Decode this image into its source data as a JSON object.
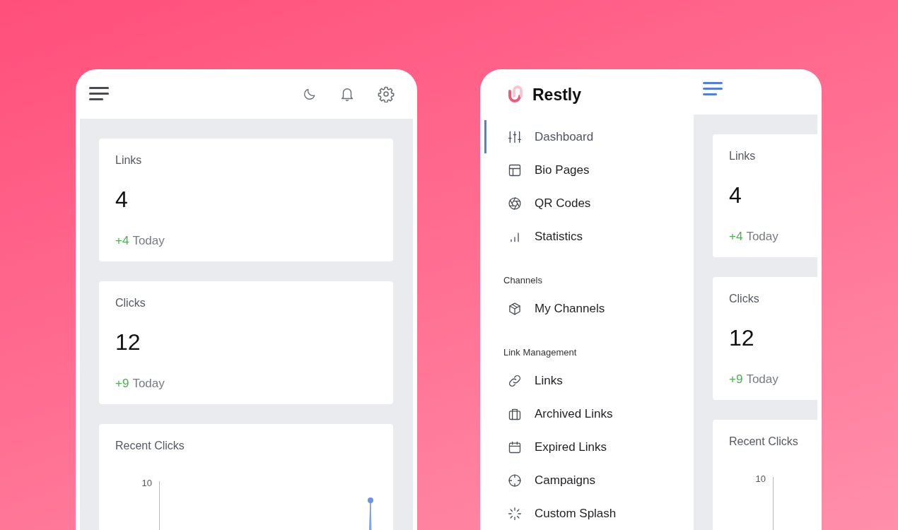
{
  "left_phone": {
    "stats": [
      {
        "label": "Links",
        "value": "4",
        "delta": "+4",
        "period": "Today"
      },
      {
        "label": "Clicks",
        "value": "12",
        "delta": "+9",
        "period": "Today"
      }
    ],
    "recent_clicks": {
      "title": "Recent Clicks",
      "y_tick": "10"
    }
  },
  "right_phone": {
    "sidebar": {
      "brand": "Restly",
      "groups": [
        {
          "items": [
            {
              "label": "Dashboard",
              "kind": "sliders",
              "selected": true
            },
            {
              "label": "Bio Pages",
              "kind": "layout",
              "selected": false
            },
            {
              "label": "QR Codes",
              "kind": "aperture",
              "selected": false
            },
            {
              "label": "Statistics",
              "kind": "bars",
              "selected": false
            }
          ]
        },
        {
          "heading": "Channels",
          "items": [
            {
              "label": "My Channels",
              "kind": "cube",
              "selected": false
            }
          ]
        },
        {
          "heading": "Link Management",
          "items": [
            {
              "label": "Links",
              "kind": "link",
              "selected": false
            },
            {
              "label": "Archived Links",
              "kind": "briefcase",
              "selected": false
            },
            {
              "label": "Expired Links",
              "kind": "calendar",
              "selected": false
            },
            {
              "label": "Campaigns",
              "kind": "crosshair",
              "selected": false
            },
            {
              "label": "Custom Splash",
              "kind": "loader",
              "selected": false
            }
          ]
        }
      ]
    },
    "stats": [
      {
        "label": "Links",
        "value": "4",
        "delta": "+4",
        "period": "Today"
      },
      {
        "label": "Clicks",
        "value": "12",
        "delta": "+9",
        "period": "Today"
      }
    ],
    "recent_clicks": {
      "title": "Recent Clicks",
      "y_tick": "10"
    }
  }
}
